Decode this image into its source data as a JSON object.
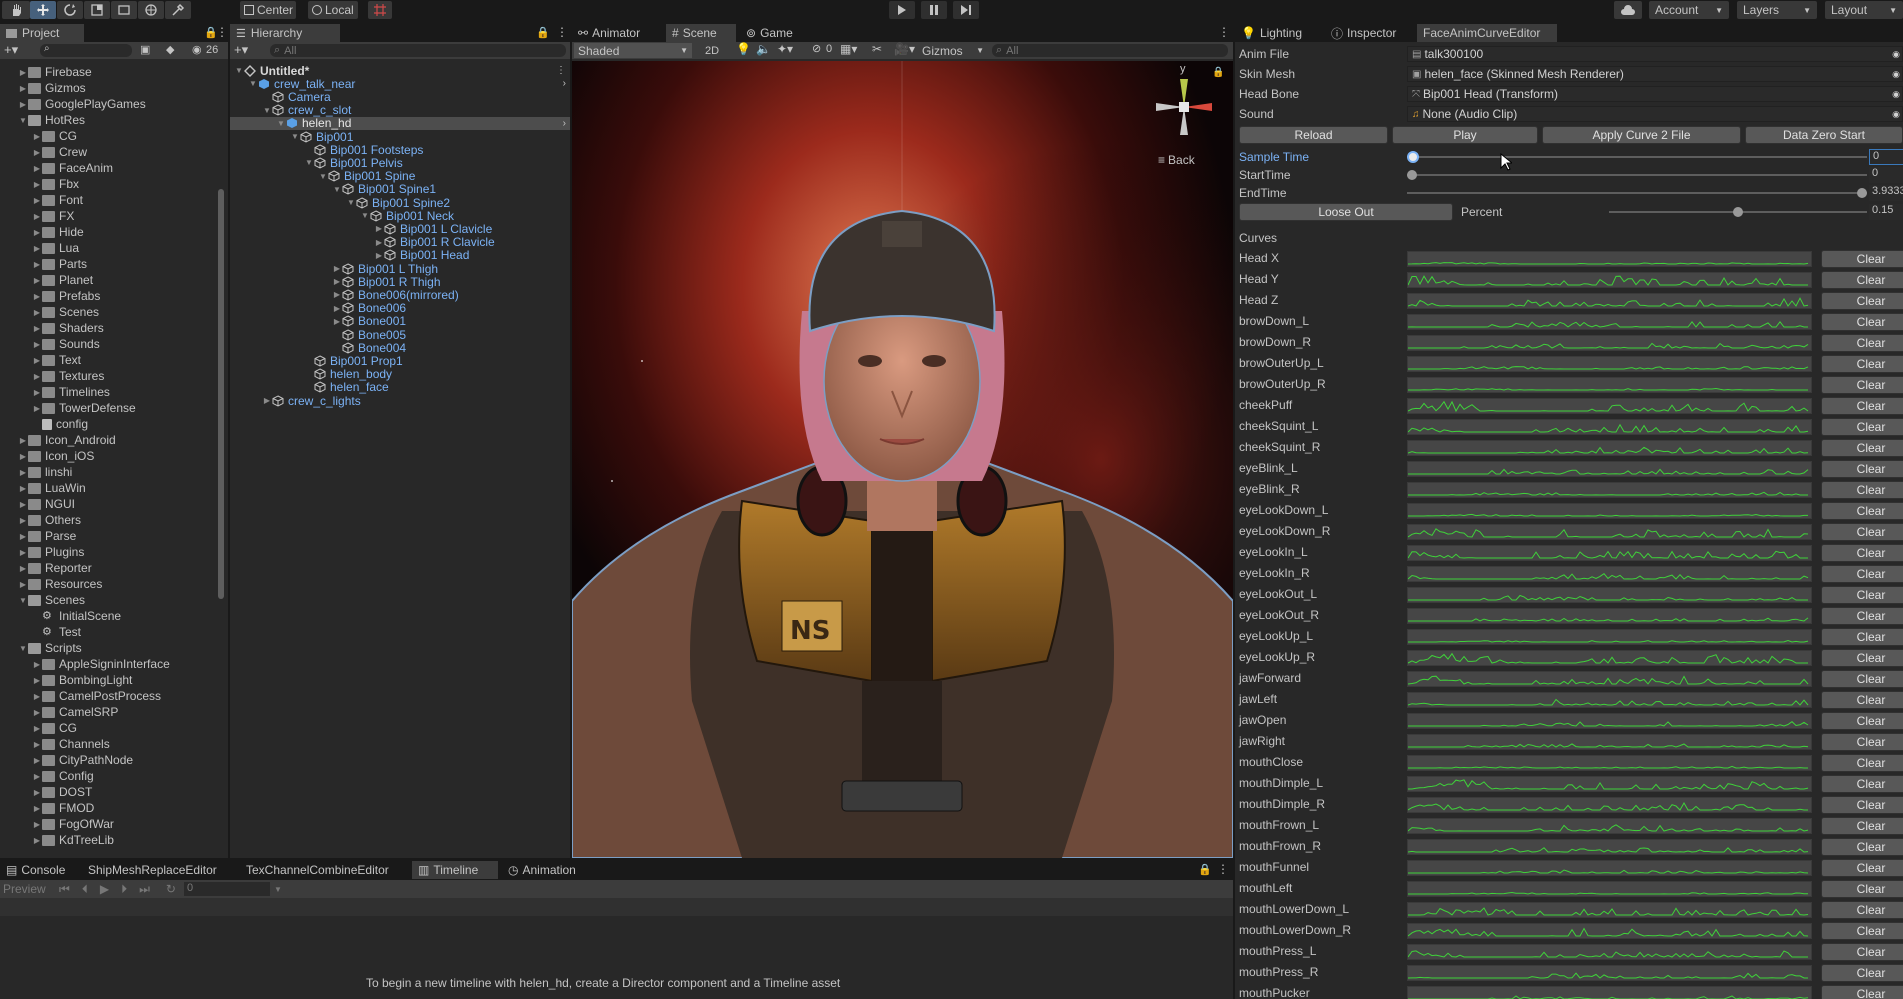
{
  "toolbar": {
    "pivot": "Center",
    "space": "Local",
    "account": "Account",
    "layers": "Layers",
    "layout": "Layout"
  },
  "project": {
    "tab": "Project",
    "hidden_count": "26",
    "items": [
      {
        "label": "Firebase",
        "depth": 1,
        "open": false
      },
      {
        "label": "Gizmos",
        "depth": 1,
        "open": false
      },
      {
        "label": "GooglePlayGames",
        "depth": 1,
        "open": false
      },
      {
        "label": "HotRes",
        "depth": 1,
        "open": true
      },
      {
        "label": "CG",
        "depth": 2,
        "open": false
      },
      {
        "label": "Crew",
        "depth": 2,
        "open": false
      },
      {
        "label": "FaceAnim",
        "depth": 2,
        "open": false
      },
      {
        "label": "Fbx",
        "depth": 2,
        "open": false
      },
      {
        "label": "Font",
        "depth": 2,
        "open": false
      },
      {
        "label": "FX",
        "depth": 2,
        "open": false
      },
      {
        "label": "Hide",
        "depth": 2,
        "open": false
      },
      {
        "label": "Lua",
        "depth": 2,
        "open": false
      },
      {
        "label": "Parts",
        "depth": 2,
        "open": false
      },
      {
        "label": "Planet",
        "depth": 2,
        "open": false
      },
      {
        "label": "Prefabs",
        "depth": 2,
        "open": false
      },
      {
        "label": "Scenes",
        "depth": 2,
        "open": false
      },
      {
        "label": "Shaders",
        "depth": 2,
        "open": false
      },
      {
        "label": "Sounds",
        "depth": 2,
        "open": false
      },
      {
        "label": "Text",
        "depth": 2,
        "open": false
      },
      {
        "label": "Textures",
        "depth": 2,
        "open": false
      },
      {
        "label": "Timelines",
        "depth": 2,
        "open": false
      },
      {
        "label": "TowerDefense",
        "depth": 2,
        "open": false
      },
      {
        "label": "config",
        "depth": 2,
        "open": false,
        "file": true
      },
      {
        "label": "Icon_Android",
        "depth": 1,
        "open": false
      },
      {
        "label": "Icon_iOS",
        "depth": 1,
        "open": false
      },
      {
        "label": "linshi",
        "depth": 1,
        "open": false
      },
      {
        "label": "LuaWin",
        "depth": 1,
        "open": false
      },
      {
        "label": "NGUI",
        "depth": 1,
        "open": false
      },
      {
        "label": "Others",
        "depth": 1,
        "open": false
      },
      {
        "label": "Parse",
        "depth": 1,
        "open": false
      },
      {
        "label": "Plugins",
        "depth": 1,
        "open": false
      },
      {
        "label": "Reporter",
        "depth": 1,
        "open": false
      },
      {
        "label": "Resources",
        "depth": 1,
        "open": false
      },
      {
        "label": "Scenes",
        "depth": 1,
        "open": true
      },
      {
        "label": "InitialScene",
        "depth": 2,
        "open": false,
        "scene": true
      },
      {
        "label": "Test",
        "depth": 2,
        "open": false,
        "scene": true
      },
      {
        "label": "Scripts",
        "depth": 1,
        "open": true
      },
      {
        "label": "AppleSigninInterface",
        "depth": 2,
        "open": false
      },
      {
        "label": "BombingLight",
        "depth": 2,
        "open": false
      },
      {
        "label": "CamelPostProcess",
        "depth": 2,
        "open": false
      },
      {
        "label": "CamelSRP",
        "depth": 2,
        "open": false
      },
      {
        "label": "CG",
        "depth": 2,
        "open": false
      },
      {
        "label": "Channels",
        "depth": 2,
        "open": false
      },
      {
        "label": "CityPathNode",
        "depth": 2,
        "open": false
      },
      {
        "label": "Config",
        "depth": 2,
        "open": false
      },
      {
        "label": "DOST",
        "depth": 2,
        "open": false
      },
      {
        "label": "FMOD",
        "depth": 2,
        "open": false
      },
      {
        "label": "FogOfWar",
        "depth": 2,
        "open": false
      },
      {
        "label": "KdTreeLib",
        "depth": 2,
        "open": false
      }
    ]
  },
  "hierarchy": {
    "tab": "Hierarchy",
    "search_placeholder": "All",
    "items": [
      {
        "label": "Untitled*",
        "depth": 0,
        "fold": "open",
        "kind": "scene"
      },
      {
        "label": "crew_talk_near",
        "depth": 1,
        "fold": "open",
        "kind": "prefab"
      },
      {
        "label": "Camera",
        "depth": 2,
        "fold": "none",
        "kind": "go"
      },
      {
        "label": "crew_c_slot",
        "depth": 2,
        "fold": "open",
        "kind": "go"
      },
      {
        "label": "helen_hd",
        "depth": 3,
        "fold": "open",
        "kind": "prefab",
        "selected": true
      },
      {
        "label": "Bip001",
        "depth": 4,
        "fold": "open",
        "kind": "go"
      },
      {
        "label": "Bip001 Footsteps",
        "depth": 5,
        "fold": "none",
        "kind": "go"
      },
      {
        "label": "Bip001 Pelvis",
        "depth": 5,
        "fold": "open",
        "kind": "go"
      },
      {
        "label": "Bip001 Spine",
        "depth": 6,
        "fold": "open",
        "kind": "go"
      },
      {
        "label": "Bip001 Spine1",
        "depth": 7,
        "fold": "open",
        "kind": "go"
      },
      {
        "label": "Bip001 Spine2",
        "depth": 8,
        "fold": "open",
        "kind": "go"
      },
      {
        "label": "Bip001 Neck",
        "depth": 9,
        "fold": "open",
        "kind": "go"
      },
      {
        "label": "Bip001 L Clavicle",
        "depth": 10,
        "fold": "closed",
        "kind": "go"
      },
      {
        "label": "Bip001 R Clavicle",
        "depth": 10,
        "fold": "closed",
        "kind": "go"
      },
      {
        "label": "Bip001 Head",
        "depth": 10,
        "fold": "closed",
        "kind": "go"
      },
      {
        "label": "Bip001 L Thigh",
        "depth": 7,
        "fold": "closed",
        "kind": "go"
      },
      {
        "label": "Bip001 R Thigh",
        "depth": 7,
        "fold": "closed",
        "kind": "go"
      },
      {
        "label": "Bone006(mirrored)",
        "depth": 7,
        "fold": "closed",
        "kind": "go"
      },
      {
        "label": "Bone006",
        "depth": 7,
        "fold": "closed",
        "kind": "go"
      },
      {
        "label": "Bone001",
        "depth": 7,
        "fold": "closed",
        "kind": "go"
      },
      {
        "label": "Bone005",
        "depth": 7,
        "fold": "none",
        "kind": "go"
      },
      {
        "label": "Bone004",
        "depth": 7,
        "fold": "none",
        "kind": "go"
      },
      {
        "label": "Bip001 Prop1",
        "depth": 5,
        "fold": "none",
        "kind": "go"
      },
      {
        "label": "helen_body",
        "depth": 5,
        "fold": "none",
        "kind": "go"
      },
      {
        "label": "helen_face",
        "depth": 5,
        "fold": "none",
        "kind": "go"
      },
      {
        "label": "crew_c_lights",
        "depth": 2,
        "fold": "closed",
        "kind": "go"
      }
    ]
  },
  "scene": {
    "tabs": [
      "Animator",
      "Scene",
      "Game"
    ],
    "shading": "Shaded",
    "mode_2d": "2D",
    "hidden": "0",
    "gizmos": "Gizmos",
    "search_placeholder": "All",
    "axis_y": "y",
    "back_label": "Back"
  },
  "inspector": {
    "tabs": [
      "Lighting",
      "Inspector",
      "FaceAnimCurveEditor"
    ],
    "fields": [
      {
        "label": "Anim File",
        "value": "talk300100"
      },
      {
        "label": "Skin Mesh",
        "value": "helen_face (Skinned Mesh Renderer)"
      },
      {
        "label": "Head Bone",
        "value": "Bip001 Head (Transform)"
      },
      {
        "label": "Sound",
        "value": "None (Audio Clip)"
      }
    ],
    "buttons": [
      "Reload",
      "Play",
      "Apply Curve 2 File",
      "Data Zero Start"
    ],
    "sample_time": {
      "label": "Sample Time",
      "value": "0",
      "fraction": 0.0
    },
    "start_time": {
      "label": "StartTime",
      "value": "0",
      "fraction": 0.0
    },
    "end_time": {
      "label": "EndTime",
      "value": "3.9333",
      "fraction": 1.0
    },
    "loose_out": "Loose Out",
    "percent": {
      "label": "Percent",
      "value": "0.15",
      "fraction": 0.5
    },
    "curves_header": "Curves",
    "clear_label": "Clear",
    "curves": [
      "Head X",
      "Head Y",
      "Head Z",
      "browDown_L",
      "browDown_R",
      "browOuterUp_L",
      "browOuterUp_R",
      "cheekPuff",
      "cheekSquint_L",
      "cheekSquint_R",
      "eyeBlink_L",
      "eyeBlink_R",
      "eyeLookDown_L",
      "eyeLookDown_R",
      "eyeLookIn_L",
      "eyeLookIn_R",
      "eyeLookOut_L",
      "eyeLookOut_R",
      "eyeLookUp_L",
      "eyeLookUp_R",
      "jawForward",
      "jawLeft",
      "jawOpen",
      "jawRight",
      "mouthClose",
      "mouthDimple_L",
      "mouthDimple_R",
      "mouthFrown_L",
      "mouthFrown_R",
      "mouthFunnel",
      "mouthLeft",
      "mouthLowerDown_L",
      "mouthLowerDown_R",
      "mouthPress_L",
      "mouthPress_R",
      "mouthPucker"
    ]
  },
  "bottom": {
    "tabs": [
      "Console",
      "ShipMeshReplaceEditor",
      "TexChannelCombineEditor",
      "Timeline",
      "Animation"
    ],
    "preview": "Preview",
    "frame": "0",
    "message": "To begin a new timeline with helen_hd, create a Director component and a Timeline asset"
  },
  "colors": {
    "accent": "#7bb2f5",
    "curve": "#3fd23a",
    "selection": "#2c5d87",
    "bg": "#282828",
    "panel_bar": "#3c3c3c"
  }
}
